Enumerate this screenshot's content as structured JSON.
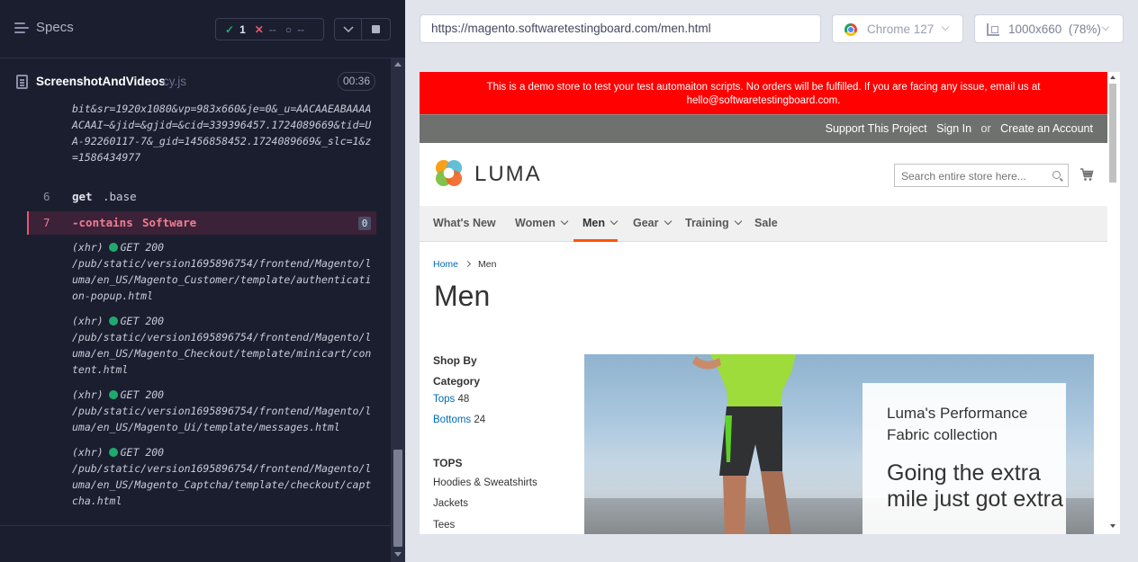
{
  "reporter": {
    "specs_label": "Specs",
    "stats": {
      "passed": "1",
      "failed": "--",
      "pending": "--"
    },
    "file_name": "ScreenshotAndVideos",
    "file_ext": "cy.js",
    "duration": "00:36",
    "url_tail": "bit&sr=1920x1080&vp=983x660&je=0&_u=AACAAEABAAAAACAAI~&jid=&gjid=&cid=339396457.1724089669&tid=UA-92260117-7&_gid=1456858452.1724089669&_slc=1&z=1586434977",
    "commands": [
      {
        "num": "6",
        "name": "get",
        "arg": ".base"
      },
      {
        "num": "7",
        "name": "-contains",
        "arg": "Software",
        "badge": "0"
      }
    ],
    "xhr": [
      {
        "label": "(xhr)",
        "method": "GET 200",
        "path": "/pub/static/version1695896754/frontend/Magento/luma/en_US/Magento_Customer/template/authentication-popup.html"
      },
      {
        "label": "(xhr)",
        "method": "GET 200",
        "path": "/pub/static/version1695896754/frontend/Magento/luma/en_US/Magento_Checkout/template/minicart/content.html"
      },
      {
        "label": "(xhr)",
        "method": "GET 200",
        "path": "/pub/static/version1695896754/frontend/Magento/luma/en_US/Magento_Ui/template/messages.html"
      },
      {
        "label": "(xhr)",
        "method": "GET 200",
        "path": "/pub/static/version1695896754/frontend/Magento/luma/en_US/Magento_Captcha/template/checkout/captcha.html"
      }
    ]
  },
  "aut": {
    "url": "https://magento.softwaretestingboard.com/men.html",
    "browser": "Chrome 127",
    "viewport": "1000x660",
    "scale": "(78%)"
  },
  "site": {
    "banner_line1": "This is a demo store to test your test automaiton scripts. No orders will be fulfilled. If you are facing any issue, email us at",
    "banner_line2": "hello@softwaretestingboard.com.",
    "header_links": {
      "support": "Support This Project",
      "signin": "Sign In",
      "or": "or",
      "create": "Create an Account"
    },
    "logo_text": "LUMA",
    "search_placeholder": "Search entire store here...",
    "nav": [
      "What's New",
      "Women",
      "Men",
      "Gear",
      "Training",
      "Sale"
    ],
    "breadcrumb": {
      "home": "Home",
      "current": "Men"
    },
    "page_title": "Men",
    "sidebar": {
      "shop_by": "Shop By",
      "category": "Category",
      "tops": "Tops",
      "tops_count": "48",
      "bottoms": "Bottoms",
      "bottoms_count": "24",
      "tops_heading": "TOPS",
      "tops_items": [
        "Hoodies & Sweatshirts",
        "Jackets",
        "Tees"
      ]
    },
    "promo": {
      "line1": "Luma's Performance Fabric collection",
      "line2": "Going the extra mile just got extra"
    }
  }
}
